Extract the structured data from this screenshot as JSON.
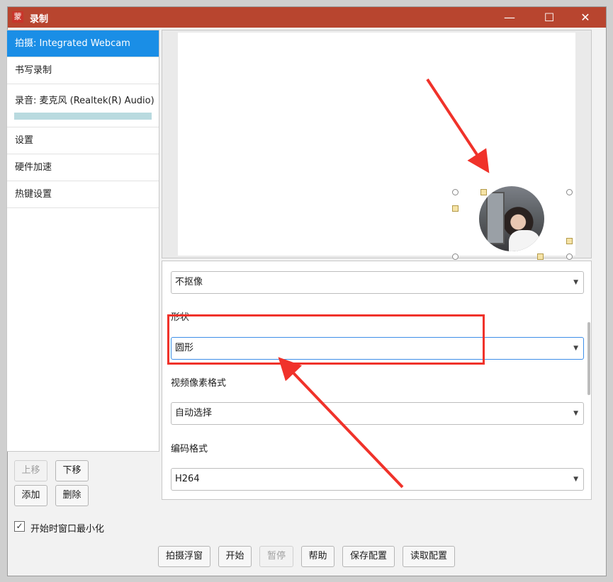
{
  "window": {
    "app_icon_text": "蒙",
    "title": "录制",
    "minimize_glyph": "—",
    "maximize_glyph": "☐",
    "close_glyph": "✕"
  },
  "sidebar": {
    "items": [
      {
        "label": "拍摄: Integrated Webcam",
        "active": true
      },
      {
        "label": "书写录制"
      },
      {
        "label": "录音: 麦克风 (Realtek(R) Audio)",
        "meter_level": 1.0
      },
      {
        "label": "设置"
      },
      {
        "label": "硬件加速"
      },
      {
        "label": "热键设置"
      }
    ]
  },
  "list_buttons": {
    "move_up": "上移",
    "move_down": "下移",
    "add": "添加",
    "delete": "删除"
  },
  "settings": {
    "matting_value": "不抠像",
    "shape_label": "形状",
    "shape_value": "圆形",
    "pixel_format_label": "视频像素格式",
    "pixel_format_value": "自动选择",
    "codec_label": "编码格式",
    "codec_value": "H264",
    "dropdown_arrow": "▼"
  },
  "minimize_on_start": {
    "label": "开始时窗口最小化",
    "checked": true,
    "check_glyph": "✓"
  },
  "bottom_buttons": {
    "float_window": "拍摄浮窗",
    "start": "开始",
    "pause": "暂停",
    "help": "帮助",
    "save_config": "保存配置",
    "load_config": "读取配置"
  },
  "colors": {
    "titlebar": "#b8452f",
    "active_item": "#1a8ee6",
    "annotation": "#f0322a"
  }
}
